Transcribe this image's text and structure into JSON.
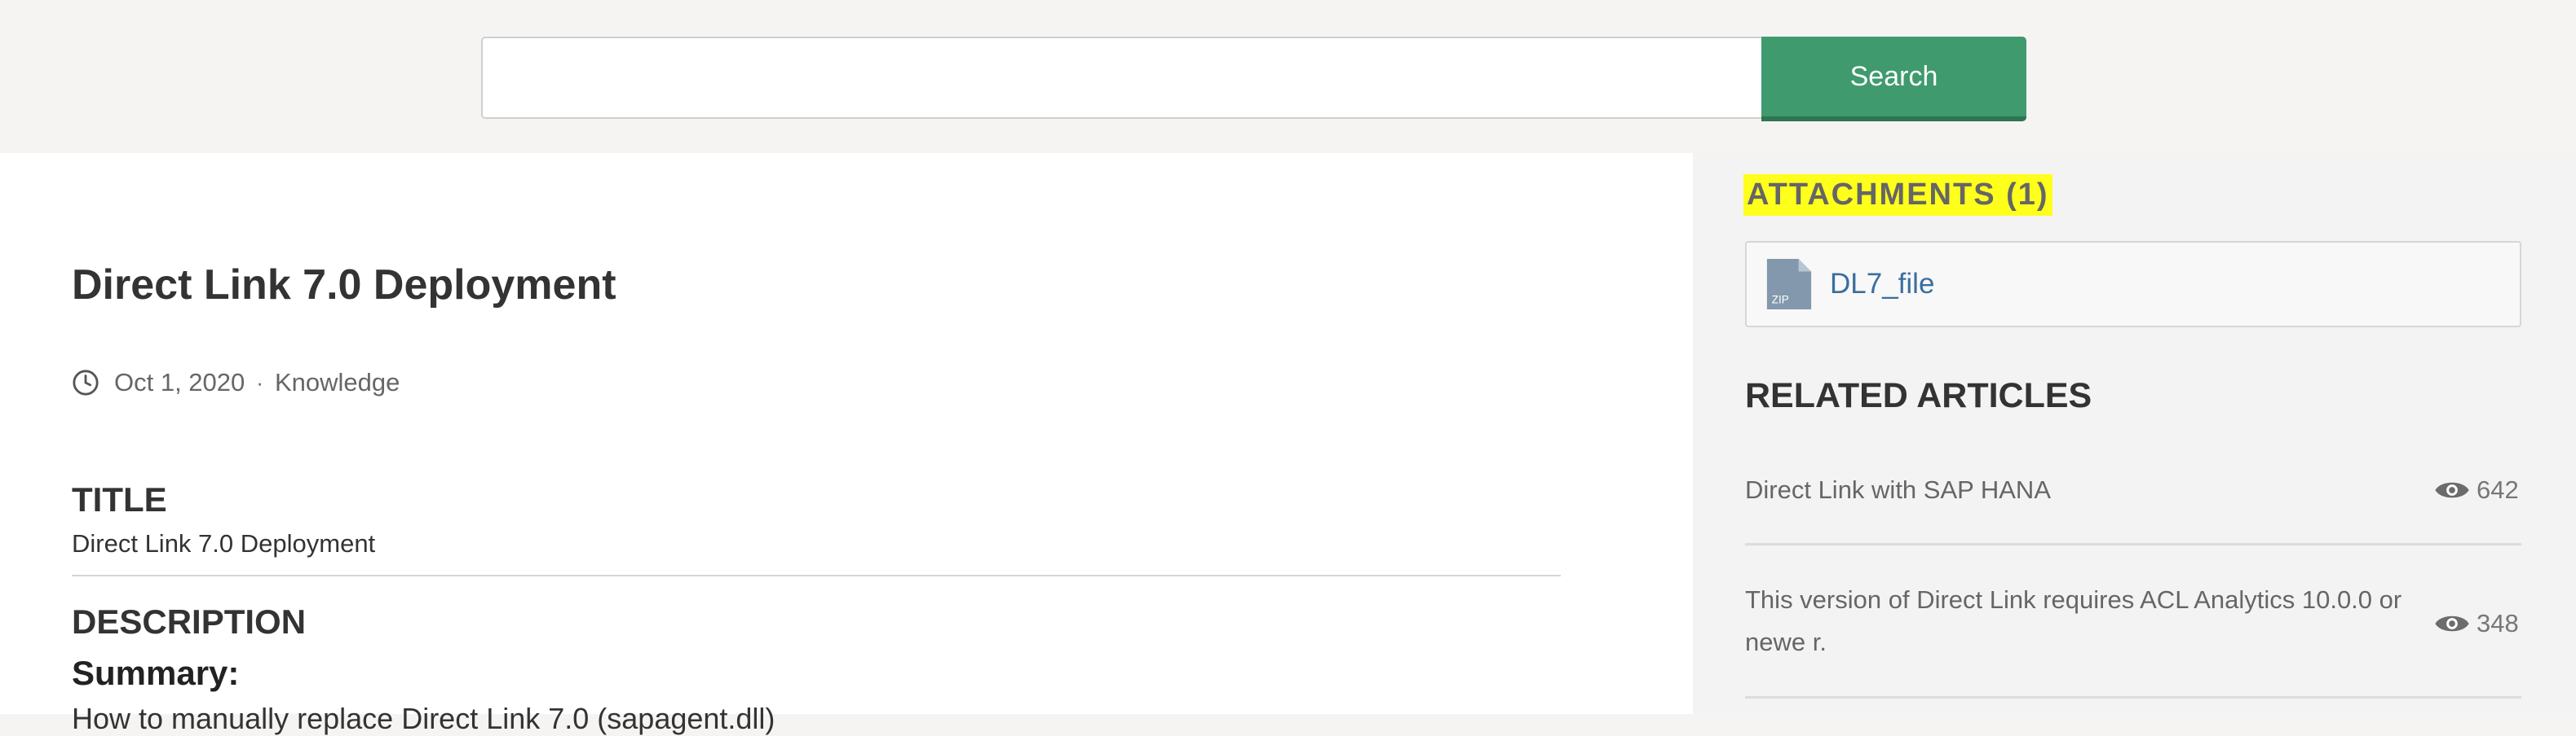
{
  "search": {
    "value": "",
    "placeholder": "",
    "button_label": "Search"
  },
  "article": {
    "title": "Direct Link 7.0 Deployment",
    "date": "Oct 1, 2020",
    "separator": "·",
    "category": "Knowledge",
    "sections": {
      "title_heading": "TITLE",
      "title_value": "Direct Link 7.0 Deployment",
      "description_heading": "DESCRIPTION",
      "summary_heading": "Summary:",
      "summary_text": "How to manually replace Direct Link 7.0 (sapagent.dll)"
    }
  },
  "sidebar": {
    "attachments_heading": "ATTACHMENTS (1)",
    "attachments": [
      {
        "name": "DL7_file",
        "icon": "zip-file-icon",
        "icon_text": "ZIP"
      }
    ],
    "related_heading": "RELATED ARTICLES",
    "related_articles": [
      {
        "title": "Direct Link with SAP HANA",
        "views": "642"
      },
      {
        "title": "This version of Direct Link requires ACL Analytics 10.0.0 or newe r.",
        "views": "348"
      }
    ]
  },
  "colors": {
    "accent_button": "#3f9a6e",
    "link": "#3a6e9f",
    "highlight": "#ffff1c"
  }
}
